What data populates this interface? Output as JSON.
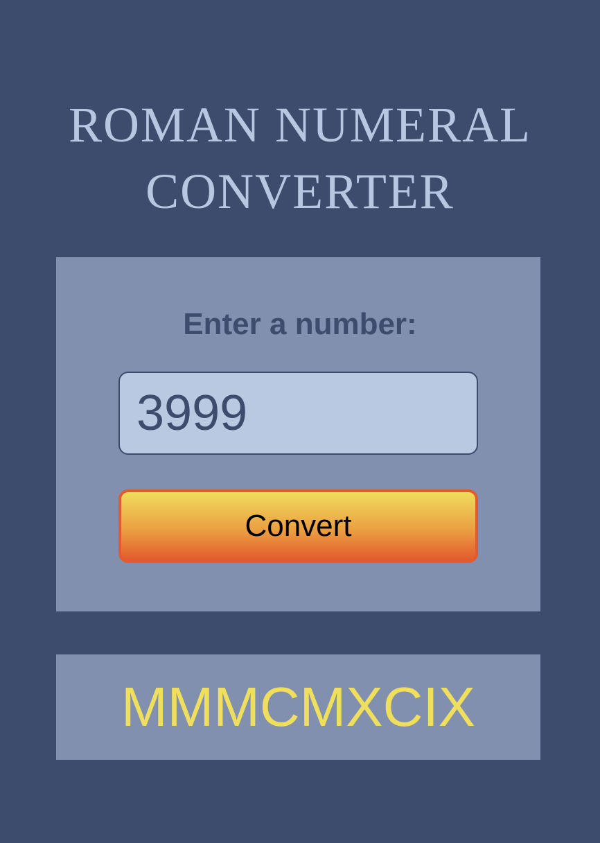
{
  "page": {
    "title_line1": "ROMAN NUMERAL",
    "title_line2": "CONVERTER"
  },
  "form": {
    "label": "Enter a number:",
    "input_value": "3999",
    "button_label": "Convert"
  },
  "result": {
    "text": "MMMCMXCIX"
  },
  "colors": {
    "background": "#3d4b6d",
    "card": "#8090ae",
    "title": "#b7c7e1",
    "input_bg": "#b8c9e1",
    "result_text": "#f0df5c",
    "button_top": "#f0dc5c",
    "button_bottom": "#e35a2e"
  }
}
